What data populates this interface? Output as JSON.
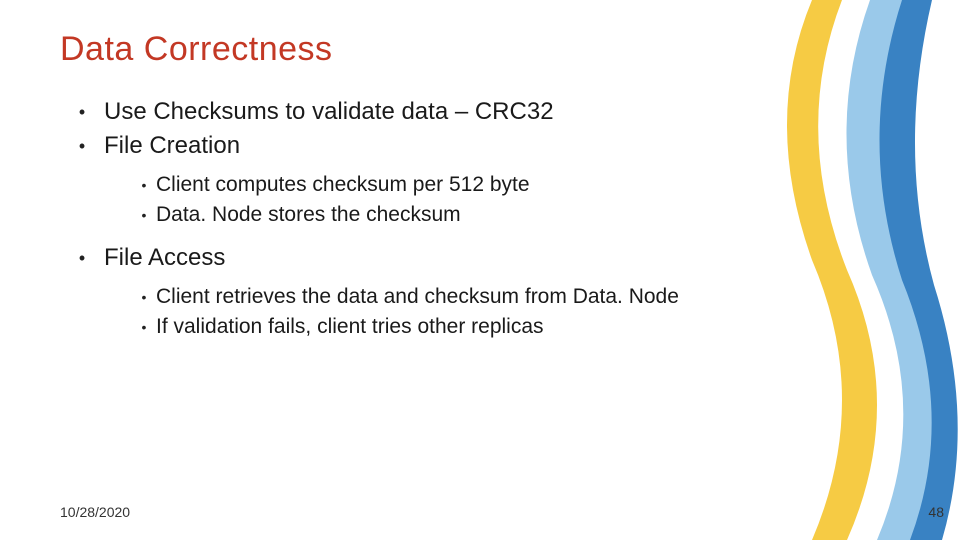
{
  "title": "Data Correctness",
  "bullets": {
    "b0": "Use Checksums to validate data – CRC32",
    "b1": "File Creation",
    "b1_sub0": "Client computes checksum per 512 byte",
    "b1_sub1": "Data. Node stores the checksum",
    "b2": "File Access",
    "b2_sub0": "Client retrieves the data and checksum from Data. Node",
    "b2_sub1": "If validation fails, client tries other replicas"
  },
  "footer": {
    "date": "10/28/2020",
    "page": "48"
  },
  "colors": {
    "title": "#c33824",
    "wave_yellow": "#f5c83a",
    "wave_blue_light": "#8fc3e8",
    "wave_blue_dark": "#2f7abf"
  }
}
